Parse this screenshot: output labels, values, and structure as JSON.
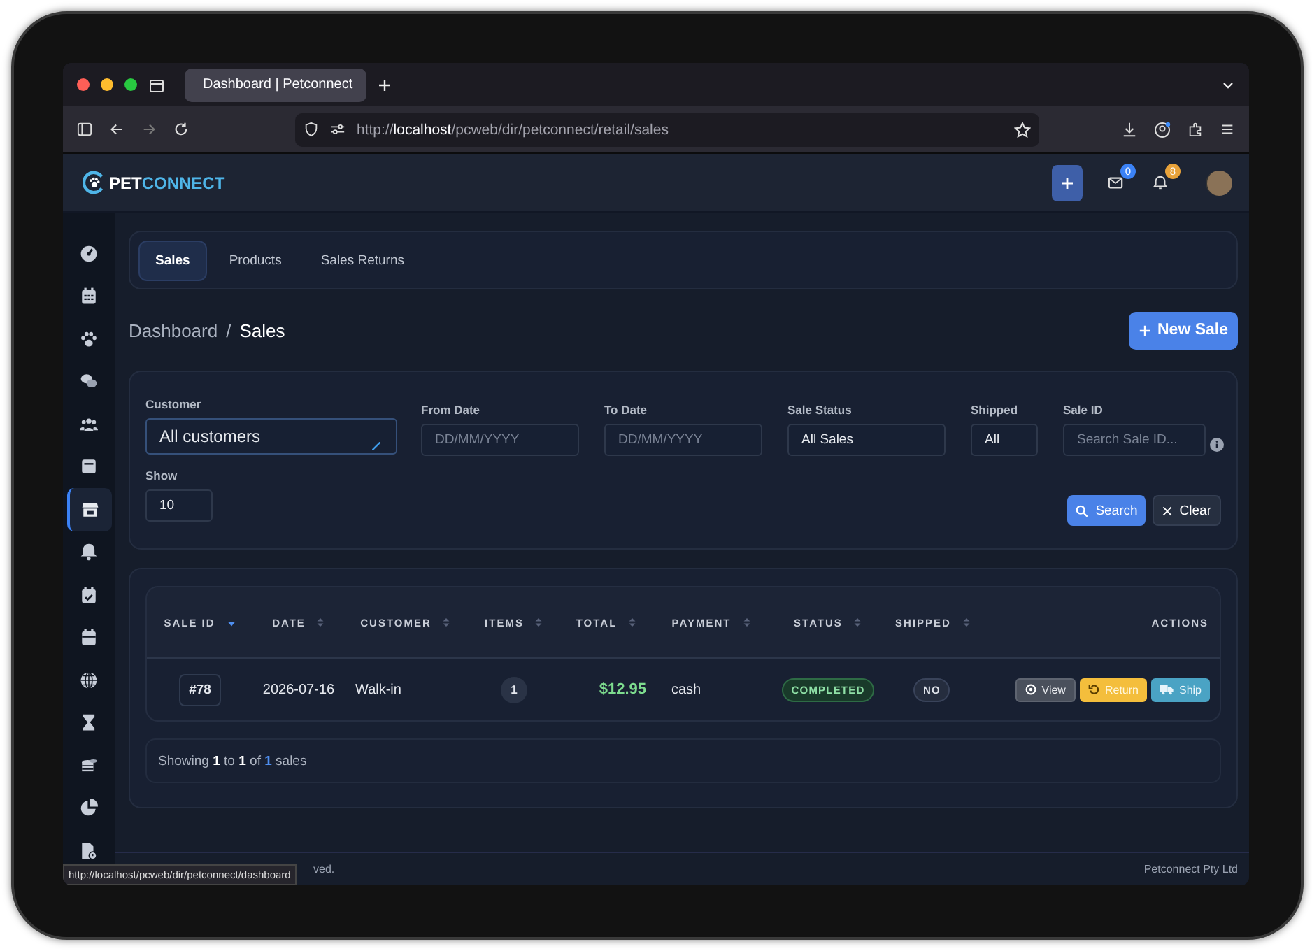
{
  "browser": {
    "tab_title": "Dashboard | Petconnect",
    "url_scheme": "http://",
    "url_host": "localhost",
    "url_path": "/pcweb/dir/petconnect/retail/sales",
    "status_url": "http://localhost/pcweb/dir/petconnect/dashboard"
  },
  "header": {
    "logo_part_1": "PET",
    "logo_part_2": "CONNECT",
    "mail_badge": "0",
    "notification_badge": "8"
  },
  "sidebar": {
    "items": [
      {
        "selected": false
      },
      {
        "selected": false
      },
      {
        "selected": false
      },
      {
        "selected": false
      },
      {
        "selected": false
      },
      {
        "selected": false
      },
      {
        "selected": true
      },
      {
        "selected": false
      },
      {
        "selected": false
      },
      {
        "selected": false
      },
      {
        "selected": false
      },
      {
        "selected": false
      },
      {
        "selected": false
      },
      {
        "selected": false
      },
      {
        "selected": false
      }
    ]
  },
  "tabs": [
    {
      "label": "Sales",
      "selected": true
    },
    {
      "label": "Products",
      "selected": false
    },
    {
      "label": "Sales Returns",
      "selected": false
    }
  ],
  "breadcrumb": {
    "items": [
      "Dashboard",
      "Sales"
    ],
    "separator": "/"
  },
  "new_sale_button": "New Sale",
  "filters": {
    "customer": {
      "label": "Customer",
      "value": "All customers"
    },
    "from_date": {
      "label": "From Date",
      "placeholder": "DD/MM/YYYY"
    },
    "to_date": {
      "label": "To Date",
      "placeholder": "DD/MM/YYYY"
    },
    "sale_status": {
      "label": "Sale Status",
      "value": "All Sales"
    },
    "shipped": {
      "label": "Shipped",
      "value": "All"
    },
    "sale_id": {
      "label": "Sale ID",
      "placeholder": "Search Sale ID..."
    },
    "show": {
      "label": "Show",
      "value": "10"
    },
    "search_button": "Search",
    "clear_button": "Clear"
  },
  "table": {
    "columns": [
      {
        "label": "SALE ID",
        "sortable": true,
        "sorted": true
      },
      {
        "label": "DATE",
        "sortable": true,
        "sorted": false
      },
      {
        "label": "CUSTOMER",
        "sortable": true,
        "sorted": false
      },
      {
        "label": "ITEMS",
        "sortable": true,
        "sorted": false
      },
      {
        "label": "TOTAL",
        "sortable": true,
        "sorted": false
      },
      {
        "label": "PAYMENT",
        "sortable": true,
        "sorted": false
      },
      {
        "label": "STATUS",
        "sortable": true,
        "sorted": false
      },
      {
        "label": "SHIPPED",
        "sortable": true,
        "sorted": false
      },
      {
        "label": "ACTIONS",
        "sortable": false,
        "sorted": false
      }
    ],
    "rows": [
      {
        "sale_id": "#78",
        "date": "2026-07-16",
        "customer": "Walk-in",
        "items": "1",
        "total": "$12.95",
        "payment": "cash",
        "status": "COMPLETED",
        "shipped": "NO",
        "actions": [
          {
            "kind": "view",
            "label": "View"
          },
          {
            "kind": "return",
            "label": "Return"
          },
          {
            "kind": "ship",
            "label": "Ship"
          }
        ]
      }
    ]
  },
  "pagination": {
    "text": "Showing **1** to **1** of",
    "total": "1",
    "suffix": "sales"
  },
  "footer": {
    "left": "ved.",
    "right": "Petconnect Pty Ltd"
  }
}
